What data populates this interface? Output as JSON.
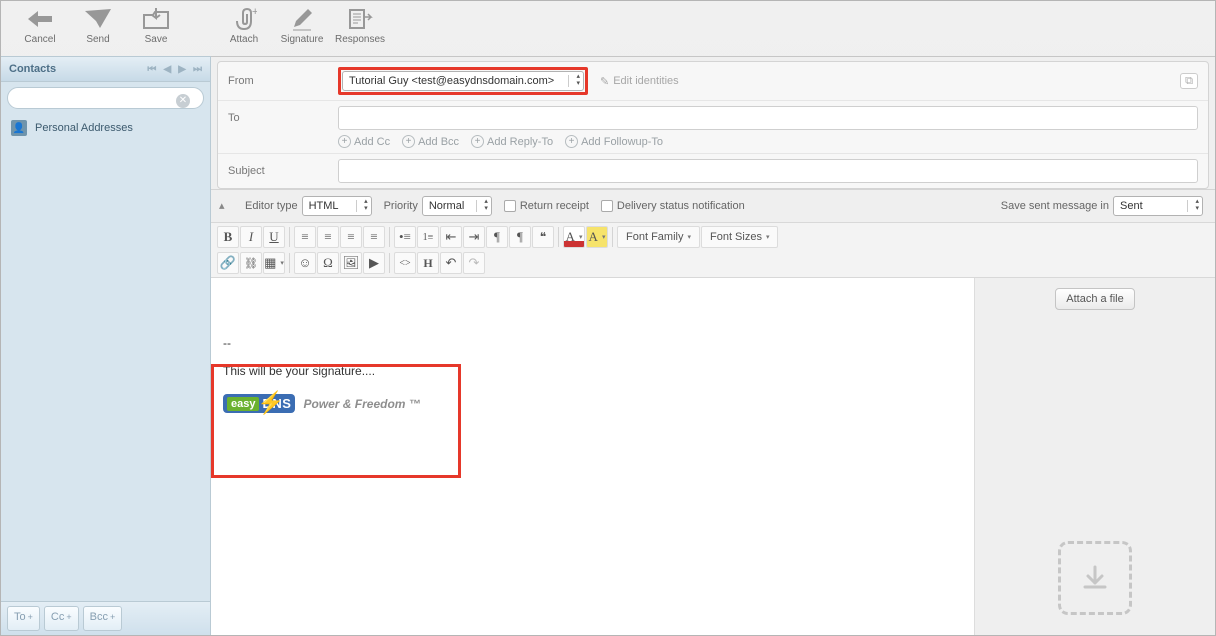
{
  "toolbar": {
    "cancel": "Cancel",
    "send": "Send",
    "save": "Save",
    "attach": "Attach",
    "signature": "Signature",
    "responses": "Responses"
  },
  "sidebar": {
    "title": "Contacts",
    "search_placeholder": "",
    "addressbook": "Personal Addresses",
    "to": "To",
    "cc": "Cc",
    "bcc": "Bcc"
  },
  "header": {
    "from_label": "From",
    "from_value": "Tutorial Guy <test@easydnsdomain.com>",
    "edit_ids": "Edit identities",
    "to_label": "To",
    "add_cc": "Add Cc",
    "add_bcc": "Add Bcc",
    "add_reply": "Add Reply-To",
    "add_follow": "Add Followup-To",
    "subject_label": "Subject"
  },
  "options": {
    "editor_type_label": "Editor type",
    "editor_type_value": "HTML",
    "priority_label": "Priority",
    "priority_value": "Normal",
    "return_receipt": "Return receipt",
    "dsn": "Delivery status notification",
    "save_in_label": "Save sent message in",
    "save_in_value": "Sent"
  },
  "editor_toolbar": {
    "font_family": "Font Family",
    "font_sizes": "Font Sizes"
  },
  "attach": {
    "button": "Attach a file"
  },
  "signature": {
    "sep": "--",
    "line": "This will be your signature....",
    "logo_easy": "easy",
    "logo_dns": "DNS",
    "tagline": "Power & Freedom ™"
  }
}
